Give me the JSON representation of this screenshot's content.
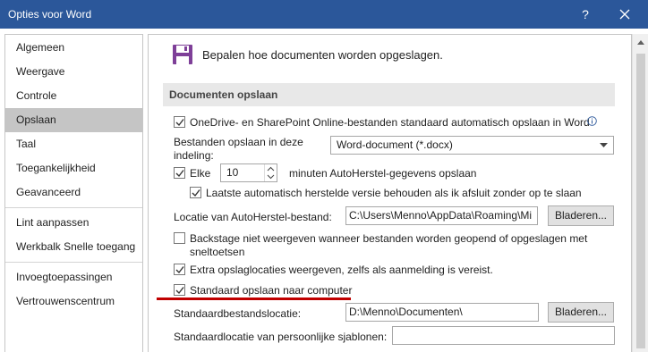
{
  "window": {
    "title": "Opties voor Word",
    "help_label": "?",
    "accent": "#2b579a"
  },
  "sidebar": {
    "items": [
      {
        "label": "Algemeen"
      },
      {
        "label": "Weergave"
      },
      {
        "label": "Controle"
      },
      {
        "label": "Opslaan"
      },
      {
        "label": "Taal"
      },
      {
        "label": "Toegankelijkheid"
      },
      {
        "label": "Geavanceerd"
      },
      {
        "label": "Lint aanpassen"
      },
      {
        "label": "Werkbalk Snelle toegang"
      },
      {
        "label": "Invoegtoepassingen"
      },
      {
        "label": "Vertrouwenscentrum"
      }
    ],
    "selected": "Opslaan"
  },
  "main": {
    "intro": "Bepalen hoe documenten worden opgeslagen.",
    "section_title": "Documenten opslaan",
    "onedrive_autosave": {
      "label": "OneDrive- en SharePoint Online-bestanden standaard automatisch opslaan in Word",
      "checked": true
    },
    "save_format": {
      "label_line1": "Bestanden opslaan in deze",
      "label_line2": "indeling:",
      "value": "Word-document (*.docx)"
    },
    "autorecover": {
      "label_pre": "Elke",
      "interval": "10",
      "label_post": "minuten AutoHerstel-gegevens opslaan",
      "checked": true
    },
    "keep_last": {
      "label": "Laatste automatisch herstelde versie behouden als ik afsluit zonder op te slaan",
      "checked": true
    },
    "autorecover_location": {
      "label": "Locatie van AutoHerstel-bestand:",
      "value": "C:\\Users\\Menno\\AppData\\Roaming\\Mi",
      "browse": "Bladeren..."
    },
    "backstage": {
      "label_line1": "Backstage niet weergeven wanneer bestanden worden geopend of opgeslagen met",
      "label_line2": "sneltoetsen",
      "checked": false
    },
    "extra_locations": {
      "label": "Extra opslaglocaties weergeven, zelfs als aanmelding is vereist.",
      "checked": true
    },
    "save_to_computer": {
      "label": "Standaard opslaan naar computer",
      "checked": true
    },
    "default_location": {
      "label": "Standaardbestandslocatie:",
      "value": "D:\\Menno\\Documenten\\",
      "browse": "Bladeren..."
    },
    "templates_location": {
      "label": "Standaardlocatie van persoonlijke sjablonen:",
      "value": ""
    }
  },
  "highlight_color": "#c00000"
}
